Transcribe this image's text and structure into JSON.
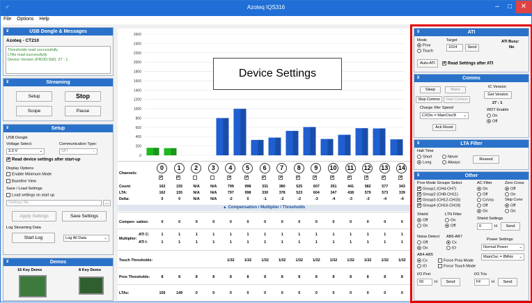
{
  "window": {
    "title": "Azoteq IQS316",
    "min": "–",
    "max": "□",
    "close": "✕"
  },
  "menu": [
    "File",
    "Options",
    "Help"
  ],
  "usb": {
    "header": "USB Dongle & Messages",
    "device": "Azoteq - CT210",
    "messages": [
      "Thresholds read successfully",
      "LTAs read successfully",
      "Device Version (PROD:SW): 27 : 1"
    ]
  },
  "streaming": {
    "header": "Streaming",
    "setup": "Setup",
    "stop": "Stop",
    "scope": "Scope",
    "pause": "Pause"
  },
  "setup": {
    "header": "Setup",
    "usb_dongle": "USB Dongle",
    "voltage_label": "Voltage Select:",
    "voltage_value": "3.3 V",
    "comm_label": "Communication Type:",
    "comm_value": "SPI",
    "read_device": "Read device settings after start-up",
    "display_options": "Display Options",
    "enable_min": "Enable Minimum Mode",
    "baseline": "Baseline View",
    "save_load": "Save / Load Settings",
    "load_startup": "Load settings on start up",
    "settings_placeholder": "Settings file...",
    "browse": "...",
    "apply": "Apply Settings",
    "save": "Save Settings",
    "log_stream": "Log Streaming Data",
    "start_log": "Start Log",
    "log_option": "Log All Data"
  },
  "demos": {
    "header": "Demos",
    "demo16": "16 Key Demo",
    "demo8": "8 Key Demo"
  },
  "overlay": "Device Settings",
  "chart_data": {
    "type": "bar",
    "categories": [
      "0",
      "1",
      "2",
      "3",
      "4",
      "5",
      "6",
      "7",
      "8",
      "9",
      "10",
      "11",
      "12",
      "13",
      "14"
    ],
    "series": [
      {
        "values": [
          162,
          155,
          0,
          0,
          799,
          998,
          331,
          380,
          525,
          607,
          351,
          441,
          582,
          577,
          343
        ]
      }
    ],
    "ylim": [
      0,
      2600
    ],
    "yticks": [
      0,
      200,
      400,
      600,
      800,
      1000,
      1200,
      1400,
      1600,
      1800,
      2000,
      2200,
      2400,
      2600
    ],
    "colors": [
      "#1fb81f",
      "#1fb81f",
      "#1f5fd0",
      "#1f5fd0",
      "#1f5fd0",
      "#1f5fd0",
      "#1f5fd0",
      "#1f5fd0",
      "#1f5fd0",
      "#1f5fd0",
      "#1f5fd0",
      "#1f5fd0",
      "#1f5fd0",
      "#1f5fd0",
      "#1f5fd0"
    ]
  },
  "grid": {
    "channels_label": "Channels:",
    "count_label": "Count:",
    "lta_label": "LTA:",
    "delta_label": "Delta:",
    "channels": [
      "0",
      "1",
      "2",
      "3",
      "4",
      "5",
      "6",
      "7",
      "8",
      "9",
      "10",
      "11",
      "12",
      "13",
      "14"
    ],
    "checked": [
      true,
      true,
      false,
      false,
      true,
      true,
      true,
      true,
      true,
      true,
      true,
      true,
      true,
      true,
      true
    ],
    "count": [
      "162",
      "155",
      "N/A",
      "N/A",
      "799",
      "998",
      "331",
      "380",
      "525",
      "607",
      "351",
      "441",
      "582",
      "577",
      "343"
    ],
    "lta": [
      "162",
      "155",
      "N/A",
      "N/A",
      "797",
      "998",
      "330",
      "378",
      "523",
      "604",
      "347",
      "438",
      "579",
      "573",
      "339"
    ],
    "delta": [
      "0",
      "0",
      "N/A",
      "N/A",
      "-2",
      "0",
      "-1",
      "-2",
      "-2",
      "-3",
      "-4",
      "-3",
      "-3",
      "-4",
      "-4"
    ],
    "cmt_header": "Compensation / Multiplier / Thresholds",
    "comp_label": "Compen-\nsation:",
    "comp": [
      "0",
      "0",
      "0",
      "0",
      "0",
      "0",
      "0",
      "0",
      "0",
      "0",
      "0",
      "0",
      "0",
      "0",
      "0"
    ],
    "mult_label": "Multiplier:",
    "atic_label": "ATI C:",
    "atii_label": "ATI I:",
    "atic": [
      "1",
      "1",
      "1",
      "1",
      "1",
      "1",
      "1",
      "1",
      "1",
      "1",
      "1",
      "1",
      "1",
      "1",
      "1"
    ],
    "atii": [
      "1",
      "1",
      "1",
      "1",
      "1",
      "1",
      "1",
      "1",
      "1",
      "1",
      "1",
      "1",
      "1",
      "1",
      "1"
    ],
    "touch_label": "Touch\nThresholds:",
    "touch": [
      "",
      "",
      "",
      "",
      "1/32",
      "1/32",
      "1/32",
      "1/32",
      "1/32",
      "1/32",
      "1/32",
      "1/32",
      "1/32",
      "1/32",
      "1/32"
    ],
    "prox_label": "Prox\nThresholds:",
    "prox": [
      "8",
      "8",
      "8",
      "8",
      "8",
      "8",
      "8",
      "8",
      "8",
      "8",
      "8",
      "8",
      "8",
      "8",
      "8"
    ],
    "ltas_label": "LTAs:",
    "ltas": [
      "155",
      "149",
      "0",
      "0",
      "0",
      "0",
      "0",
      "0",
      "0",
      "0",
      "0",
      "0",
      "0",
      "0",
      "0"
    ]
  },
  "ati": {
    "header": "ATI",
    "mode": "Mode",
    "prox": "Prox",
    "touch": "Touch",
    "target": "Target",
    "target_value": "1024",
    "send": "Send",
    "busy_label": "ATI Busy:",
    "busy_value": "No",
    "auto_ati": "Auto-ATI",
    "read_after": "Read Settings after ATI"
  },
  "comms": {
    "header": "Comms",
    "sleep": "Sleep",
    "wake": "Wake",
    "stop_comms": "Stop Comms",
    "start_comms": "Start Comms",
    "charge_speed": "Charge Xfer Speed",
    "charge_value": "CXDiv = MainOsc/8",
    "ack_reset": "Ack Reset",
    "ic_version": "IC Version",
    "get_version": "Get Version",
    "version_value": "27 : 1",
    "wdt": "WDT Enable",
    "on": "On",
    "off": "Off"
  },
  "lta_filter": {
    "header": "LTA Filter",
    "halt_time": "Halt Time",
    "short": "Short",
    "long": "Long",
    "never": "Never",
    "always": "Always",
    "reseed": "Reseed"
  },
  "other": {
    "header": "Other",
    "prox_mode": "Prox Mode Groupe Select",
    "groups": [
      "Group1 (CH4-CH7)",
      "Group2 (CH8-CH11)",
      "Group3 (CH12-CH15)",
      "Group4 (CH16-CH19)"
    ],
    "ac_filter": "AC Filter",
    "on": "On",
    "off": "Off",
    "zero_cross": "Zero Cross",
    "cxvss": "CxVss",
    "skip_conv": "Skip Conv",
    "shield": "Shield",
    "lta_filter": "LTN Filter",
    "shield_settings": "Shield Settings",
    "shield_value": "0",
    "h": "H",
    "send": "Send",
    "noise_detect": "Noise Detect",
    "ab6": "AB6-AB7",
    "cx": "Cx",
    "io": "IO",
    "power_settings": "Power Settings",
    "power_value": "Normal Power",
    "mainosc": "MainOsc = 8MHz",
    "ab4": "AB4-AB5",
    "force_prox": "Force Prox Mode",
    "force_touch": "Force Touch Mode",
    "io_port": "I/O Port",
    "io_port_value": "00",
    "io_tris": "I/O Tris",
    "io_tris_value": "FF"
  }
}
